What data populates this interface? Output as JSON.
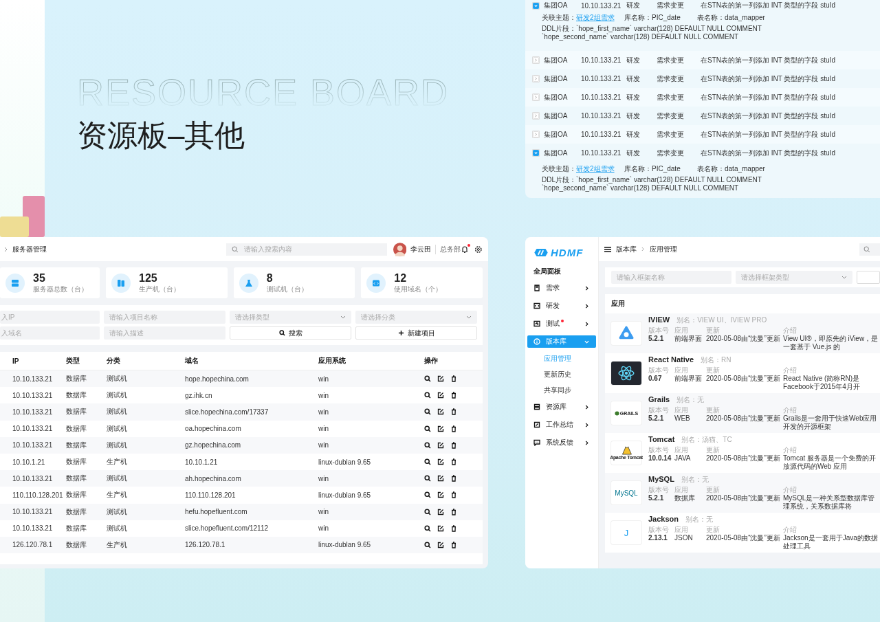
{
  "hero": {
    "title_en": "RESOURCE BOARD",
    "title": "资源板–其他"
  },
  "changes": {
    "rows": [
      {
        "expanded": true,
        "project": "集团OA",
        "ip": "10.10.133.21",
        "dept": "研发",
        "type": "需求变更",
        "description": "在STN表的第一列添加 INT 类型的字段 stuId",
        "topic_label": "关联主题：",
        "topic": "研发2组需求",
        "db": "库名称：PIC_date",
        "table": "表名称：data_mapper",
        "ddl": [
          "DDL片段：`hope_first_name` varchar(128) DEFAULT NULL COMMENT",
          "`hope_second_name` varchar(128) DEFAULT NULL COMMENT"
        ]
      },
      {
        "expanded": false,
        "project": "集团OA",
        "ip": "10.10.133.21",
        "dept": "研发",
        "type": "需求变更",
        "description": "在STN表的第一列添加 INT 类型的字段 stuId"
      },
      {
        "expanded": false,
        "project": "集团OA",
        "ip": "10.10.133.21",
        "dept": "研发",
        "type": "需求变更",
        "description": "在STN表的第一列添加 INT 类型的字段 stuId"
      },
      {
        "expanded": false,
        "project": "集团OA",
        "ip": "10.10.133.21",
        "dept": "研发",
        "type": "需求变更",
        "description": "在STN表的第一列添加 INT 类型的字段 stuId"
      },
      {
        "expanded": false,
        "project": "集团OA",
        "ip": "10.10.133.21",
        "dept": "研发",
        "type": "需求变更",
        "description": "在STN表的第一列添加 INT 类型的字段 stuId"
      },
      {
        "expanded": false,
        "project": "集团OA",
        "ip": "10.10.133.21",
        "dept": "研发",
        "type": "需求变更",
        "description": "在STN表的第一列添加 INT 类型的字段 stuId"
      },
      {
        "expanded": true,
        "project": "集团OA",
        "ip": "10.10.133.21",
        "dept": "研发",
        "type": "需求变更",
        "description": "在STN表的第一列添加 INT 类型的字段 stuId",
        "topic_label": "关联主题：",
        "topic": "研发2组需求",
        "db": "库名称：PIC_date",
        "table": "表名称：data_mapper",
        "ddl": [
          "DDL片段：`hope_first_name` varchar(128) DEFAULT NULL COMMENT",
          "`hope_second_name` varchar(128) DEFAULT NULL COMMENT"
        ]
      }
    ]
  },
  "servers": {
    "breadcrumb": "服务器管理",
    "search": {
      "placeholder": "请输入搜索内容"
    },
    "user": {
      "name": "李云田",
      "dept": "总务部"
    },
    "notifications": {
      "unread": true
    },
    "stats": [
      {
        "value": "35",
        "label": "服务器总数（台）"
      },
      {
        "value": "125",
        "label": "生产机（台）"
      },
      {
        "value": "8",
        "label": "测试机（台）"
      },
      {
        "value": "12",
        "label": "使用域名（个）"
      }
    ],
    "filters": [
      {
        "kind": "input",
        "placeholder": "入IP"
      },
      {
        "kind": "input",
        "placeholder": "请输入项目名称"
      },
      {
        "kind": "select",
        "placeholder": "请选择类型"
      },
      {
        "kind": "select",
        "placeholder": "请选择分类"
      },
      {
        "kind": "input",
        "placeholder": "入域名"
      },
      {
        "kind": "input",
        "placeholder": "请输入描述"
      },
      {
        "kind": "search",
        "label": "搜索"
      },
      {
        "kind": "create",
        "label": "新建项目"
      }
    ],
    "table": {
      "columns": [
        "IP",
        "类型",
        "分类",
        "域名",
        "应用系统",
        "操作"
      ],
      "rows": [
        [
          "10.10.133.21",
          "数据库",
          "测试机",
          "hope.hopechina.com",
          "win"
        ],
        [
          "10.10.133.21",
          "数据库",
          "测试机",
          "gz.ihk.cn",
          "win"
        ],
        [
          "10.10.133.21",
          "数据库",
          "测试机",
          "slice.hopechina.com/17337",
          "win"
        ],
        [
          "10.10.133.21",
          "数据库",
          "测试机",
          "oa.hopechina.com",
          "win"
        ],
        [
          "10.10.133.21",
          "数据库",
          "测试机",
          "gz.hopechina.com",
          "win"
        ],
        [
          "10.10.1.21",
          "数据库",
          "生产机",
          "10.10.1.21",
          "linux-dublan 9.65"
        ],
        [
          "10.10.133.21",
          "数据库",
          "测试机",
          "ah.hopechina.com",
          "win"
        ],
        [
          "110.110.128.201",
          "数据库",
          "生产机",
          "110.110.128.201",
          "linux-dublan 9.65"
        ],
        [
          "10.10.133.21",
          "数据库",
          "测试机",
          "hefu.hopefluent.com",
          "win"
        ],
        [
          "10.10.133.21",
          "数据库",
          "测试机",
          "slice.hopefluent.com/12112",
          "win"
        ],
        [
          "126.120.78.1",
          "数据库",
          "生产机",
          "126.120.78.1",
          "linux-dublan 9.65"
        ]
      ]
    }
  },
  "apps": {
    "logo": "HDMF",
    "overview": "全局面板",
    "menu": [
      {
        "label": "需求",
        "alert": false,
        "selected": false,
        "expanded": false
      },
      {
        "label": "研发",
        "alert": false,
        "selected": false,
        "expanded": false
      },
      {
        "label": "测试",
        "alert": true,
        "selected": false,
        "expanded": false
      },
      {
        "label": "版本库",
        "alert": false,
        "selected": true,
        "expanded": true,
        "children": [
          {
            "label": "应用管理",
            "selected": true
          },
          {
            "label": "更新历史",
            "selected": false
          },
          {
            "label": "共享同步",
            "selected": false
          }
        ]
      },
      {
        "label": "资源库",
        "alert": false,
        "selected": false,
        "expanded": false
      },
      {
        "label": "工作总结",
        "alert": false,
        "selected": false,
        "expanded": false
      },
      {
        "label": "系统反馈",
        "alert": false,
        "selected": false,
        "expanded": false
      }
    ],
    "breadcrumb": [
      "版本库",
      "应用管理"
    ],
    "filters": [
      {
        "kind": "input",
        "placeholder": "请输入框架名称"
      },
      {
        "kind": "select",
        "placeholder": "请选择框架类型"
      },
      {
        "kind": "input"
      }
    ],
    "section": "应用",
    "items": [
      {
        "name": "IVIEW",
        "alias": "别名：VIEW UI、IVIEW PRO",
        "fields": [
          {
            "label": "版本号",
            "value": "5.2.1"
          },
          {
            "label": "应用",
            "value": "前端界面"
          },
          {
            "label": "更新",
            "value": "2020-05-08由“沈曼”更新"
          },
          {
            "label": "介绍",
            "value": "View UI®，即原先的 iView，是一套基于 Vue.js 的"
          }
        ]
      },
      {
        "name": "React Native",
        "alias": "别名：RN",
        "fields": [
          {
            "label": "版本号",
            "value": "0.67"
          },
          {
            "label": "应用",
            "value": "前端界面"
          },
          {
            "label": "更新",
            "value": "2020-05-08由“沈曼”更新"
          },
          {
            "label": "介绍",
            "value": "React Native (简称RN)是Facebook于2015年4月开"
          }
        ]
      },
      {
        "name": "Grails",
        "alias": "别名：无",
        "logo_text": "GRAILS",
        "fields": [
          {
            "label": "版本号",
            "value": "5.2.1"
          },
          {
            "label": "应用",
            "value": "WEB"
          },
          {
            "label": "更新",
            "value": "2020-05-08由“沈曼”更新"
          },
          {
            "label": "介绍",
            "value": "Grails是一套用于快速Web应用开发的开源框架"
          }
        ]
      },
      {
        "name": "Tomcat",
        "alias": "别名：汤猫、TC",
        "logo_text": "Apache Tomcat",
        "fields": [
          {
            "label": "版本号",
            "value": "10.0.14"
          },
          {
            "label": "应用",
            "value": "JAVA"
          },
          {
            "label": "更新",
            "value": "2020-05-08由“沈曼”更新"
          },
          {
            "label": "介绍",
            "value": "Tomcat 服务器是一个免费的开放源代码的Web 应用"
          }
        ]
      },
      {
        "name": "MySQL",
        "alias": "别名：无",
        "logo_text": "MySQL",
        "fields": [
          {
            "label": "版本号",
            "value": "5.2.1"
          },
          {
            "label": "应用",
            "value": "数据库"
          },
          {
            "label": "更新",
            "value": "2020-05-08由“沈曼”更新"
          },
          {
            "label": "介绍",
            "value": "MySQL是一种关系型数据库管理系统，关系数据库将"
          }
        ]
      },
      {
        "name": "Jackson",
        "alias": "别名：无",
        "logo_text": "J",
        "fields": [
          {
            "label": "版本号",
            "value": "2.13.1"
          },
          {
            "label": "应用",
            "value": "JSON"
          },
          {
            "label": "更新",
            "value": "2020-05-08由“沈曼”更新"
          },
          {
            "label": "介绍",
            "value": "Jackson是一套用于Java的数据处理工具"
          }
        ]
      }
    ]
  }
}
